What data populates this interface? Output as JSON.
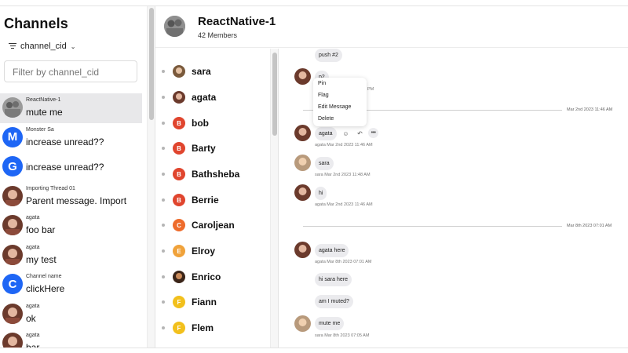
{
  "sidebar": {
    "title": "Channels",
    "sort_label": "channel_cid",
    "search_placeholder": "Filter by channel_cid",
    "channels": [
      {
        "name": "ReactNative-1",
        "last_message": "mute me",
        "avatar": "group-photo",
        "active": true
      },
      {
        "name": "Monster Sa",
        "last_message": "increase unread??",
        "avatar_letter": "M"
      },
      {
        "name": "",
        "last_message": "increase unread??",
        "avatar_letter": "G"
      },
      {
        "name": "Importing Thread 01",
        "last_message": "Parent message. Import",
        "avatar": "user-photo"
      },
      {
        "name": "agata",
        "last_message": "foo bar",
        "avatar": "user-photo"
      },
      {
        "name": "agata",
        "last_message": "my test",
        "avatar": "user-photo"
      },
      {
        "name": "Channel name",
        "last_message": "clickHere",
        "avatar_letter": "C"
      },
      {
        "name": "agata",
        "last_message": "ok",
        "avatar": "user-photo"
      },
      {
        "name": "agata",
        "last_message": "bar",
        "avatar": "user-photo"
      }
    ]
  },
  "header": {
    "title": "ReactNative-1",
    "member_count": "42 Members"
  },
  "members": [
    {
      "name": "sara",
      "avatar": "photo-sara"
    },
    {
      "name": "agata",
      "avatar": "photo-agata"
    },
    {
      "name": "bob",
      "avatar_letter": "B",
      "color": "#e0452e"
    },
    {
      "name": "Barty",
      "avatar_letter": "B",
      "color": "#e0452e"
    },
    {
      "name": "Bathsheba",
      "avatar_letter": "B",
      "color": "#e0452e"
    },
    {
      "name": "Berrie",
      "avatar_letter": "B",
      "color": "#e0452e"
    },
    {
      "name": "Caroljean",
      "avatar_letter": "C",
      "color": "#ee6c2c"
    },
    {
      "name": "Elroy",
      "avatar_letter": "E",
      "color": "#f0a23a"
    },
    {
      "name": "Enrico",
      "avatar": "photo-enrico"
    },
    {
      "name": "Fiann",
      "avatar_letter": "F",
      "color": "#f2c01c"
    },
    {
      "name": "Flem",
      "avatar_letter": "F",
      "color": "#f2c01c"
    }
  ],
  "messages": {
    "push_text": "push #2",
    "p2_text": "p2",
    "p2_time_fragment": "PM",
    "divider1_date": "Mar 2nd 2023 11:46 AM",
    "agata_text": "agata",
    "agata_meta": "agata Mar 2nd 2023 11:46 AM",
    "sara_text": "sara",
    "sara_meta": "sara Mar 2nd 2023 11:48 AM",
    "hi_text": "hi",
    "hi_meta": "agata Mar 2nd 2023 11:46 AM",
    "divider2_date": "Mar 8th 2023 07:01 AM",
    "agata_here_text": "agata here",
    "agata_here_meta": "agata Mar 8th 2023 07:01 AM",
    "hi_sara_text": "hi sara here",
    "am_i_muted_text": "am I muted?",
    "mute_me_text": "mute me",
    "mute_me_meta": "sara Mar 8th 2023 07:05 AM"
  },
  "context_menu": {
    "items": [
      "Pin",
      "Flag",
      "Edit Message",
      "Delete"
    ]
  },
  "icons": {
    "reaction": "smiley-icon",
    "reply": "reply-icon",
    "more": "more-icon"
  },
  "colors": {
    "accent_blue": "#1e66f5",
    "bubble_bg": "#ebebee",
    "active_channel_bg": "#e8e8ea"
  }
}
